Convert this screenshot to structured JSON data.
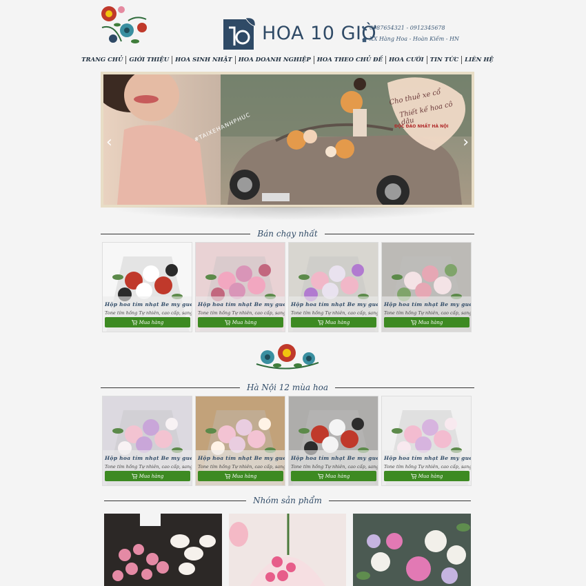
{
  "brand": {
    "name": "HOA 10 GIỜ"
  },
  "contact": {
    "phones": "0987654321 - 0912345678",
    "address": "XX Hàng Hoa - Hoàn Kiếm - HN"
  },
  "nav": [
    "TRANG CHỦ",
    "GIỚI THIỆU",
    "HOA SINH NHẬT",
    "HOA DOANH NGHIỆP",
    "HOA THEO CHỦ ĐỀ",
    "HOA CƯỚI",
    "TIN TỨC",
    "LIÊN HỆ"
  ],
  "slider": {
    "slogan_line1": "Cho thuê xe cổ",
    "slogan_line2": "Thiết kế hoa cô dâu",
    "slogan_line3": "ĐỘC ĐÁO NHẤT HÀ NỘI",
    "hashtag": "#TAIXEHANHPHUC",
    "prev_icon": "chevron-left-icon",
    "next_icon": "chevron-right-icon"
  },
  "sections": {
    "best_sellers": "Bán chạy nhất",
    "seasons": "Hà Nội 12 mùa hoa",
    "groups": "Nhóm sản phẩm"
  },
  "best_sellers": [
    {
      "name": "Hộp hoa tím nhạt Be my guest",
      "desc": "Tone tím hồng Tự nhiên, cao cấp, sang",
      "buy": "Mua hàng"
    },
    {
      "name": "Hộp hoa tím nhạt Be my guest",
      "desc": "Tone tím hồng Tự nhiên, cao cấp, sang",
      "buy": "Mua hàng"
    },
    {
      "name": "Hộp hoa tím nhạt Be my guest",
      "desc": "Tone tím hồng Tự nhiên, cao cấp, sang",
      "buy": "Mua hàng"
    },
    {
      "name": "Hộp hoa tím nhạt Be my guest",
      "desc": "Tone tím hồng Tự nhiên, cao cấp, sang",
      "buy": "Mua hàng"
    }
  ],
  "seasons": [
    {
      "name": "Hộp hoa tím nhạt Be my guest",
      "desc": "Tone tím hồng Tự nhiên, cao cấp, sang",
      "buy": "Mua hàng"
    },
    {
      "name": "Hộp hoa tím nhạt Be my guest",
      "desc": "Tone tím hồng Tự nhiên, cao cấp, sang",
      "buy": "Mua hàng"
    },
    {
      "name": "Hộp hoa tím nhạt Be my guest",
      "desc": "Tone tím hồng Tự nhiên, cao cấp, sang",
      "buy": "Mua hàng"
    },
    {
      "name": "Hộp hoa tím nhạt Be my guest",
      "desc": "Tone tím hồng Tự nhiên, cao cấp, sang",
      "buy": "Mua hàng"
    }
  ],
  "colors": {
    "brand": "#2f4a66",
    "buy_button": "#3d8a22",
    "background": "#f4f4f4"
  }
}
